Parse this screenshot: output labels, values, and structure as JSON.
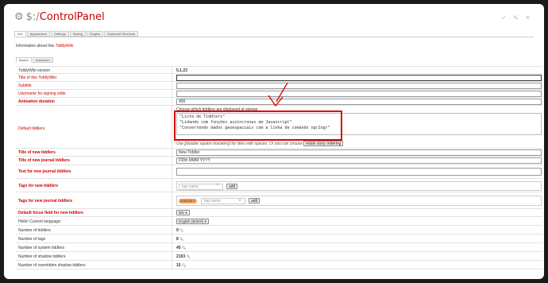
{
  "header": {
    "title_prefix": "$:/",
    "title_main": "ControlPanel",
    "gear_glyph": "⚙",
    "tb_close": "✓",
    "tb_edit": "✎",
    "tb_fold": "✕"
  },
  "tabs": [
    "Info",
    "Appearance",
    "Settings",
    "Saving",
    "Plugins",
    "Keyboard Shortcuts"
  ],
  "intro": {
    "prefix": "Information about this ",
    "link": "TiddlyWiki"
  },
  "subtabs": [
    "Basics",
    "Advanced"
  ],
  "rows": {
    "version_label": "TiddlyWiki version",
    "version_value": "5.1.23",
    "title_label": "Title of this TiddlyWiki",
    "subtitle_label": "Subtitle",
    "username_label": "Username for signing edits",
    "anim_label": "Animation duration",
    "anim_value": "400",
    "default_label": "Default tiddlers",
    "default_hint": "Choose which tiddlers are displayed at startup",
    "default_tiddlers": [
      "\"Lista de Tiddlers\"",
      "\"Lidando com funções assíncronas em Javascript\"",
      "\"Convertendo dados geoespaciais com a linha de comando ogr2ogr\""
    ],
    "default_footer": "Use [[double square brackets]] for titles with spaces. Or you can choose to",
    "retain_button": "retain story ordering",
    "newtid_label": "Title of new tiddlers",
    "newtid_value": "New Tiddler",
    "newjournal_label": "Title of new journal tiddlers",
    "newjournal_value": "DDth MMM YYYY",
    "textjournal_label": "Text for new journal tiddlers",
    "tagsnew_label": "Tags for new tiddlers",
    "tagsnew_placeholder": "tag name",
    "add_button": "add",
    "tagsjournal_label": "Tags for new journal tiddlers",
    "journal_pill": "Journal ×",
    "focus_label": "Default focus field for new tiddlers",
    "focus_value": "title ▾",
    "lang_label": "Hello! Current language:",
    "lang_value": "English (British) ▾",
    "num_tiddlers_label": "Number of tiddlers",
    "num_tiddlers": "9",
    "num_tags_label": "Number of tags",
    "num_tags": "8",
    "num_system_label": "Number of system tiddlers",
    "num_system": "45",
    "num_shadow_label": "Number of shadow tiddlers",
    "num_shadow": "2193",
    "num_override_label": "Number of overridden shadow tiddlers",
    "num_override": "15",
    "search_glyph": "🔍"
  },
  "colors": {
    "accent": "#cc0000",
    "annotation": "#dd0000",
    "pill": "#f0a560"
  }
}
